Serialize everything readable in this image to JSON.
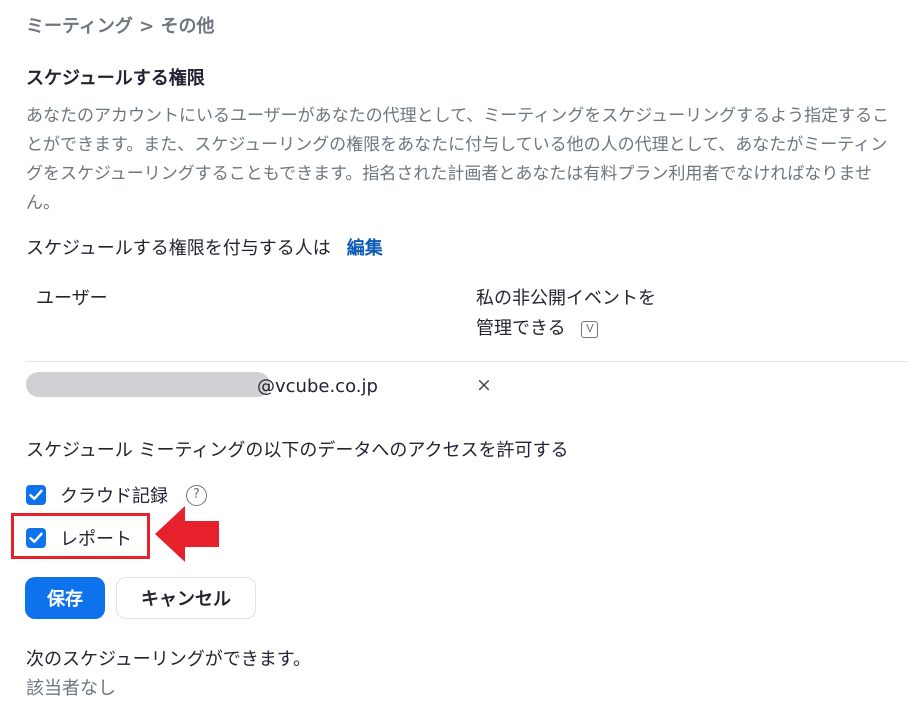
{
  "breadcrumb": "ミーティング > その他",
  "section": {
    "title": "スケジュールする権限",
    "description": "あなたのアカウントにいるユーザーがあなたの代理として、ミーティングをスケジューリングするよう指定することができます。また、スケジューリングの権限をあなたに付与している他の人の代理として、あなたがミーティングをスケジューリングすることもできます。指名された計画者とあなたは有料プラン利用者でなければなりません。"
  },
  "assign": {
    "label": "スケジュールする権限を付与する人は",
    "edit_link": "編集"
  },
  "table": {
    "col_user": "ユーザー",
    "col_private_line1": "私の非公開イベントを",
    "col_private_line2": "管理できる",
    "rows": [
      {
        "email_domain": "@vcube.co.jp",
        "private_value": "×"
      }
    ]
  },
  "access": {
    "title": "スケジュール ミーティングの以下のデータへのアクセスを許可する",
    "options": [
      {
        "label": "クラウド記録",
        "checked": true
      },
      {
        "label": "レポート",
        "checked": true
      }
    ]
  },
  "buttons": {
    "save": "保存",
    "cancel": "キャンセル"
  },
  "can_schedule": {
    "title": "次のスケジューリングができます。",
    "value": "該当者なし"
  },
  "colors": {
    "accent": "#0e72ed",
    "link": "#0e5bb5",
    "highlight": "#e6212c"
  },
  "icons": {
    "info": "info-icon",
    "help": "help-icon",
    "check": "check-icon",
    "annotation_arrow": "left-arrow-icon"
  }
}
